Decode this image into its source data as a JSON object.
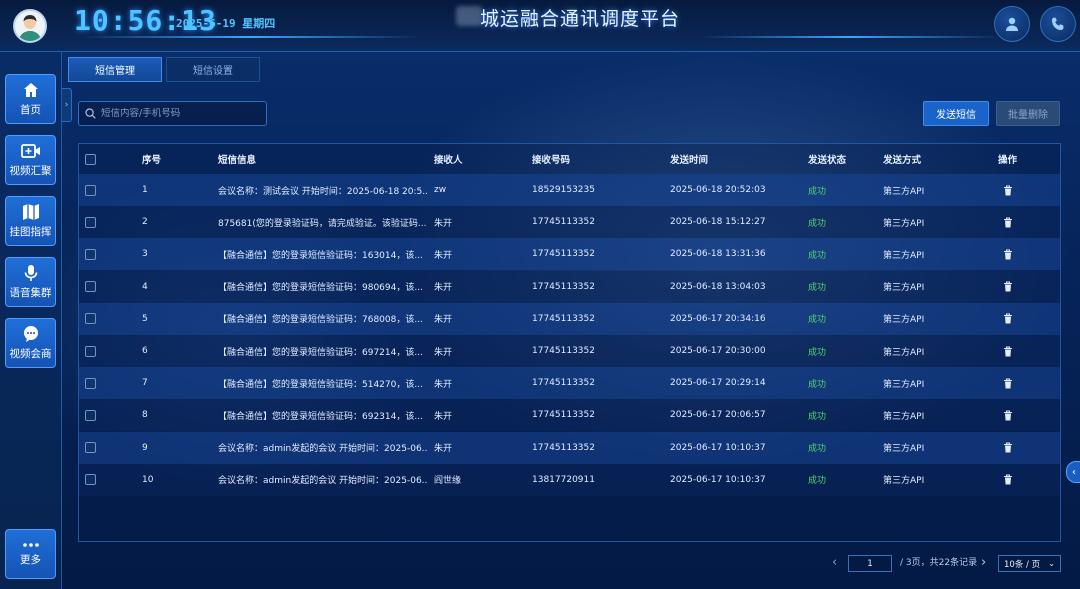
{
  "header": {
    "time": "10:56:13",
    "date": "2025-6-19 星期四",
    "title": "城运融合通讯调度平台"
  },
  "sidebar": {
    "items": [
      {
        "label": "首页",
        "icon": "home-icon"
      },
      {
        "label": "视频汇聚",
        "icon": "video-icon"
      },
      {
        "label": "挂图指挥",
        "icon": "map-icon"
      },
      {
        "label": "语音集群",
        "icon": "microphone-icon"
      },
      {
        "label": "视频会商",
        "icon": "chat-bubble-icon"
      }
    ],
    "more_label": "更多"
  },
  "tabs": [
    {
      "label": "短信管理",
      "active": true
    },
    {
      "label": "短信设置",
      "active": false
    }
  ],
  "search": {
    "placeholder": "短信内容/手机号码"
  },
  "toolbar": {
    "send_label": "发送短信",
    "batch_delete_label": "批量删除"
  },
  "table": {
    "headers": [
      "序号",
      "短信信息",
      "接收人",
      "接收号码",
      "发送时间",
      "发送状态",
      "发送方式",
      "操作"
    ],
    "rows": [
      {
        "no": "1",
        "info": "会议名称：测试会议 开始时间：2025-06-18 20:5...",
        "receiver": "zw",
        "phone": "18529153235",
        "time": "2025-06-18 20:52:03",
        "status": "成功",
        "method": "第三方API"
      },
      {
        "no": "2",
        "info": "875681(您的登录验证码，请完成验证。该验证码...",
        "receiver": "朱开",
        "phone": "17745113352",
        "time": "2025-06-18 15:12:27",
        "status": "成功",
        "method": "第三方API"
      },
      {
        "no": "3",
        "info": "【融合通信】您的登录短信验证码：163014，该...",
        "receiver": "朱开",
        "phone": "17745113352",
        "time": "2025-06-18 13:31:36",
        "status": "成功",
        "method": "第三方API"
      },
      {
        "no": "4",
        "info": "【融合通信】您的登录短信验证码：980694，该...",
        "receiver": "朱开",
        "phone": "17745113352",
        "time": "2025-06-18 13:04:03",
        "status": "成功",
        "method": "第三方API"
      },
      {
        "no": "5",
        "info": "【融合通信】您的登录短信验证码：768008，该...",
        "receiver": "朱开",
        "phone": "17745113352",
        "time": "2025-06-17 20:34:16",
        "status": "成功",
        "method": "第三方API"
      },
      {
        "no": "6",
        "info": "【融合通信】您的登录短信验证码：697214，该...",
        "receiver": "朱开",
        "phone": "17745113352",
        "time": "2025-06-17 20:30:00",
        "status": "成功",
        "method": "第三方API"
      },
      {
        "no": "7",
        "info": "【融合通信】您的登录短信验证码：514270，该...",
        "receiver": "朱开",
        "phone": "17745113352",
        "time": "2025-06-17 20:29:14",
        "status": "成功",
        "method": "第三方API"
      },
      {
        "no": "8",
        "info": "【融合通信】您的登录短信验证码：692314，该...",
        "receiver": "朱开",
        "phone": "17745113352",
        "time": "2025-06-17 20:06:57",
        "status": "成功",
        "method": "第三方API"
      },
      {
        "no": "9",
        "info": "会议名称：admin发起的会议 开始时间：2025-06...",
        "receiver": "朱开",
        "phone": "17745113352",
        "time": "2025-06-17 10:10:37",
        "status": "成功",
        "method": "第三方API"
      },
      {
        "no": "10",
        "info": "会议名称：admin发起的会议 开始时间：2025-06...",
        "receiver": "阎世缘",
        "phone": "13817720911",
        "time": "2025-06-17 10:10:37",
        "status": "成功",
        "method": "第三方API"
      }
    ]
  },
  "pagination": {
    "current_page": "1",
    "summary": "/ 3页，共22条记录",
    "page_size": "10条 / 页"
  },
  "colors": {
    "accent": "#1a63c9",
    "success": "#54d26b"
  }
}
